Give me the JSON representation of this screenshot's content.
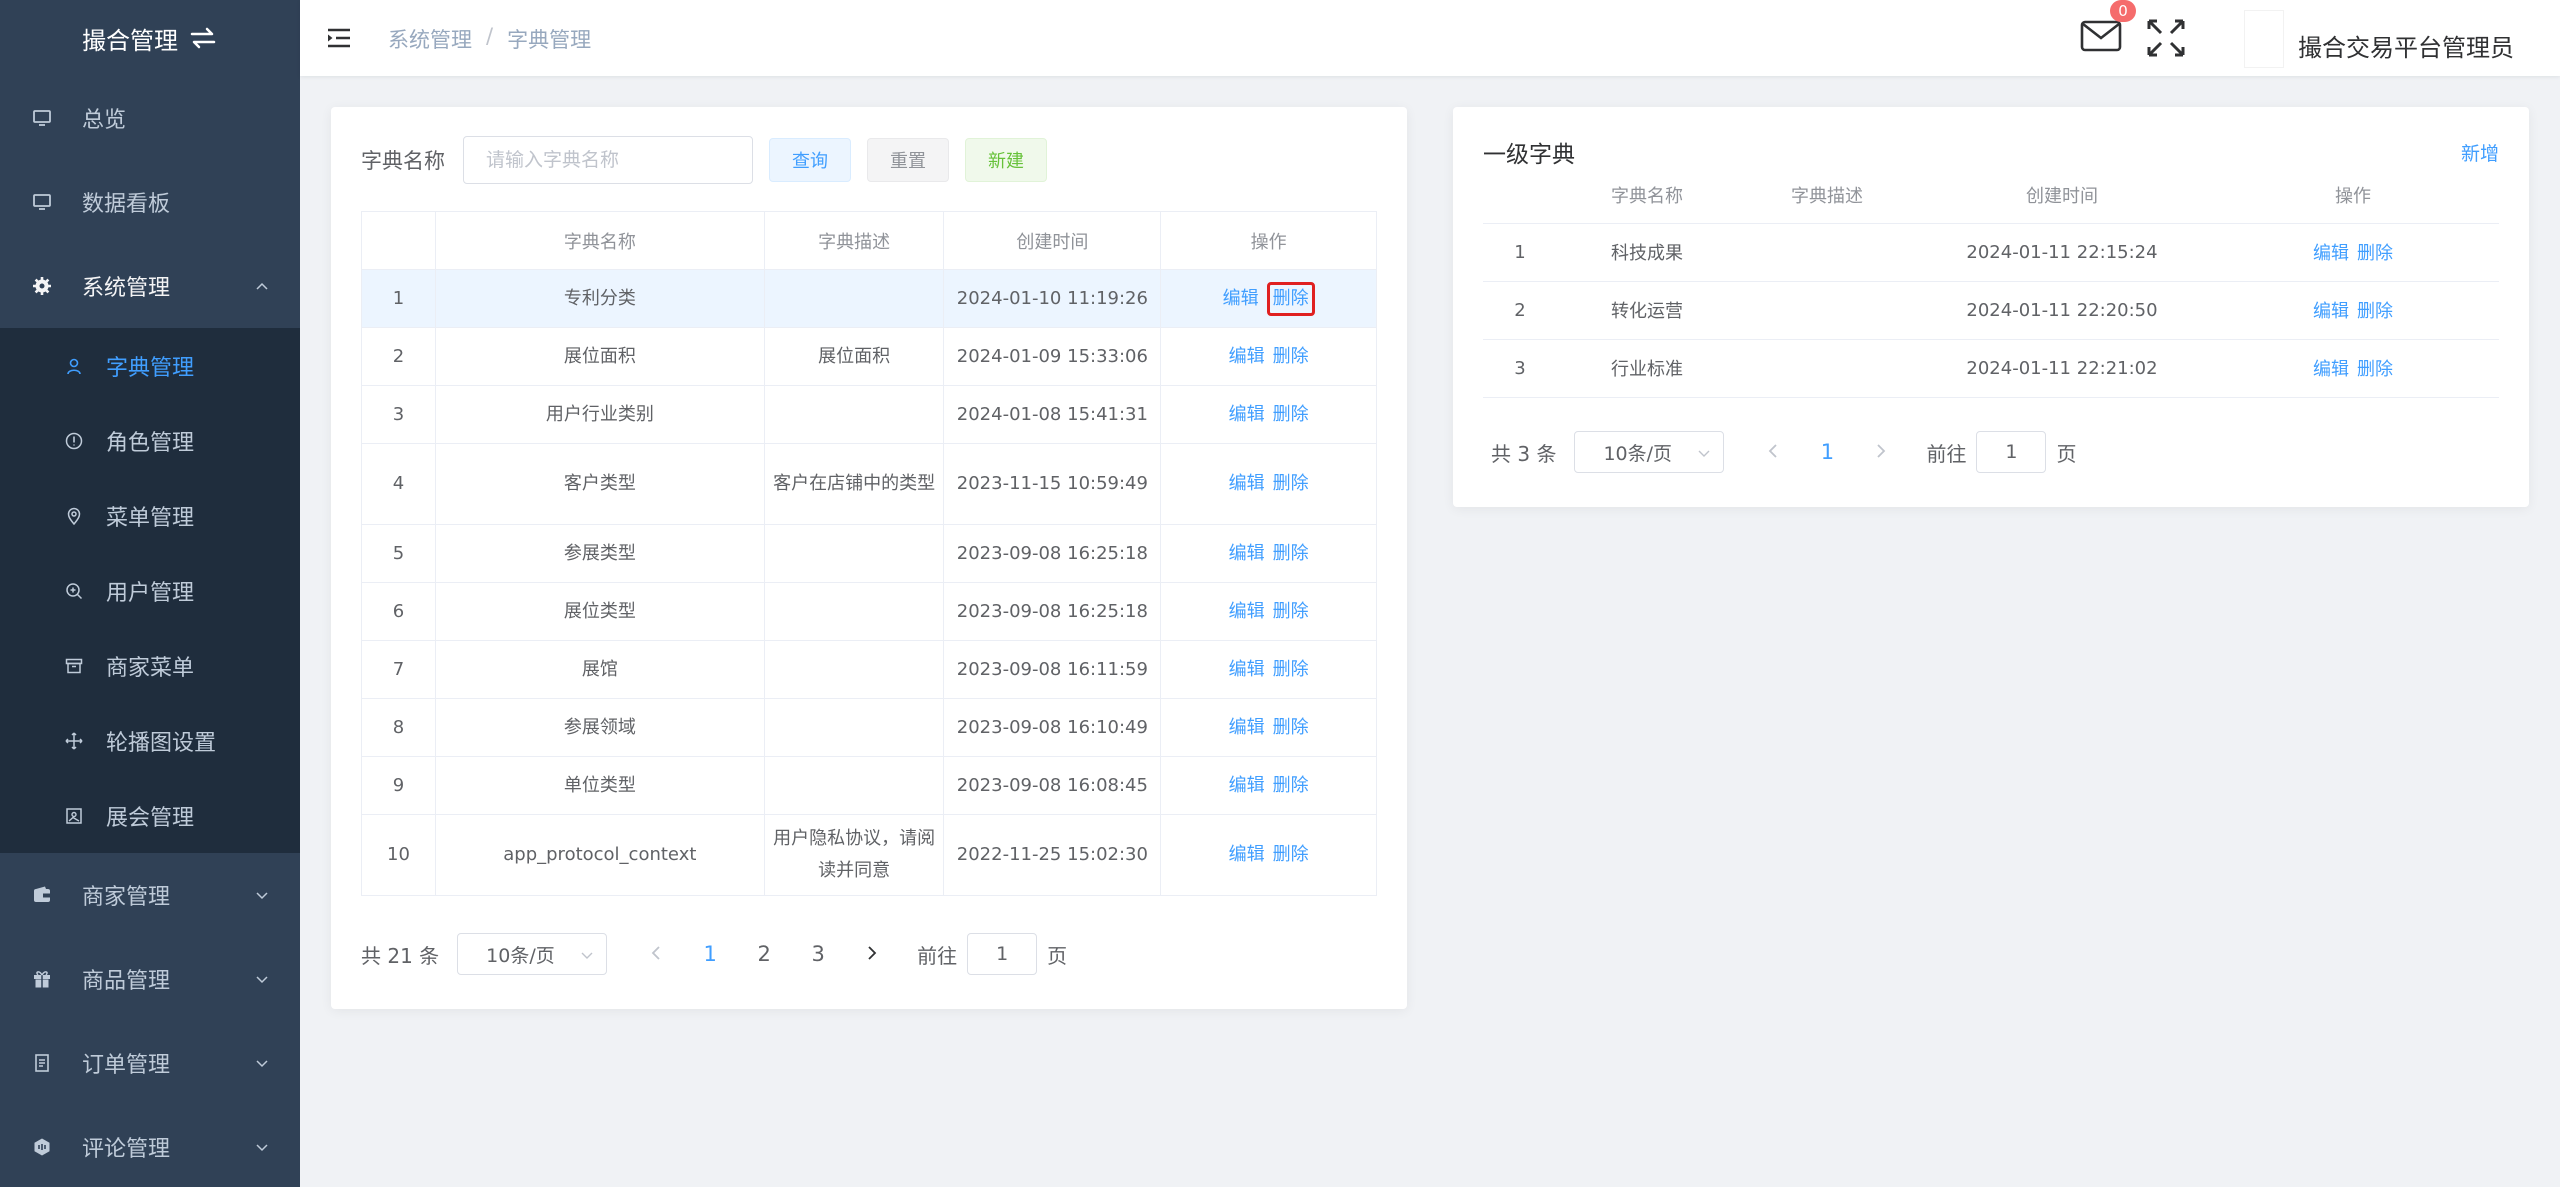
{
  "sidebar": {
    "logo_text": "撮合管理",
    "menu": [
      {
        "label": "总览",
        "icon": "monitor-icon"
      },
      {
        "label": "数据看板",
        "icon": "monitor-icon"
      },
      {
        "label": "系统管理",
        "icon": "gear-icon"
      }
    ],
    "submenu": [
      {
        "label": "字典管理",
        "icon": "user-icon",
        "active": true
      },
      {
        "label": "角色管理",
        "icon": "info-circle-icon"
      },
      {
        "label": "菜单管理",
        "icon": "location-pin-icon"
      },
      {
        "label": "用户管理",
        "icon": "zoom-in-icon"
      },
      {
        "label": "商家菜单",
        "icon": "box-icon"
      },
      {
        "label": "轮播图设置",
        "icon": "move-icon"
      },
      {
        "label": "展会管理",
        "icon": "picture-icon"
      }
    ],
    "menu_bottom": [
      {
        "label": "商家管理",
        "icon": "wallet-icon"
      },
      {
        "label": "商品管理",
        "icon": "present-icon"
      },
      {
        "label": "订单管理",
        "icon": "document-icon"
      },
      {
        "label": "评论管理",
        "icon": "comment-icon"
      }
    ]
  },
  "header": {
    "breadcrumb": [
      "系统管理",
      "字典管理"
    ],
    "breadcrumb_sep": "/",
    "mail_badge": "0",
    "username": "撮合交易平台管理员"
  },
  "left": {
    "search_label": "字典名称",
    "search_placeholder": "请输入字典名称",
    "btn_query": "查询",
    "btn_reset": "重置",
    "btn_new": "新建",
    "columns": [
      "",
      "字典名称",
      "字典描述",
      "创建时间",
      "操作"
    ],
    "action_edit": "编辑",
    "action_delete": "删除",
    "rows": [
      {
        "no": "1",
        "name": "专利分类",
        "desc": "",
        "time": "2024-01-10 11:19:26"
      },
      {
        "no": "2",
        "name": "展位面积",
        "desc": "展位面积",
        "time": "2024-01-09 15:33:06"
      },
      {
        "no": "3",
        "name": "用户行业类别",
        "desc": "",
        "time": "2024-01-08 15:41:31"
      },
      {
        "no": "4",
        "name": "客户类型",
        "desc": "客户在店铺中的类型",
        "time": "2023-11-15 10:59:49"
      },
      {
        "no": "5",
        "name": "参展类型",
        "desc": "",
        "time": "2023-09-08 16:25:18"
      },
      {
        "no": "6",
        "name": "展位类型",
        "desc": "",
        "time": "2023-09-08 16:25:18"
      },
      {
        "no": "7",
        "name": "展馆",
        "desc": "",
        "time": "2023-09-08 16:11:59"
      },
      {
        "no": "8",
        "name": "参展领域",
        "desc": "",
        "time": "2023-09-08 16:10:49"
      },
      {
        "no": "9",
        "name": "单位类型",
        "desc": "",
        "time": "2023-09-08 16:08:45"
      },
      {
        "no": "10",
        "name": "app_protocol_context",
        "desc": "用户隐私协议，请阅读并同意",
        "time": "2022-11-25 15:02:30"
      }
    ],
    "pager": {
      "total": "共 21 条",
      "size": "10条/页",
      "pages": [
        "1",
        "2",
        "3"
      ],
      "goto_label": "前往",
      "goto_value": "1",
      "page_unit": "页"
    }
  },
  "right": {
    "title": "一级字典",
    "add_label": "新增",
    "columns": [
      "",
      "字典名称",
      "字典描述",
      "创建时间",
      "操作"
    ],
    "action_edit": "编辑",
    "action_delete": "删除",
    "rows": [
      {
        "no": "1",
        "name": "科技成果",
        "desc": "",
        "time": "2024-01-11 22:15:24"
      },
      {
        "no": "2",
        "name": "转化运营",
        "desc": "",
        "time": "2024-01-11 22:20:50"
      },
      {
        "no": "3",
        "name": "行业标准",
        "desc": "",
        "time": "2024-01-11 22:21:02"
      }
    ],
    "pager": {
      "total": "共 3 条",
      "size": "10条/页",
      "pages": [
        "1"
      ],
      "goto_label": "前往",
      "goto_value": "1",
      "page_unit": "页"
    }
  },
  "colors": {
    "sidebar_bg": "#304156",
    "submenu_bg": "#1f2d3d",
    "primary": "#409eff",
    "highlight_box": "#e02020",
    "badge": "#f56c6c"
  }
}
